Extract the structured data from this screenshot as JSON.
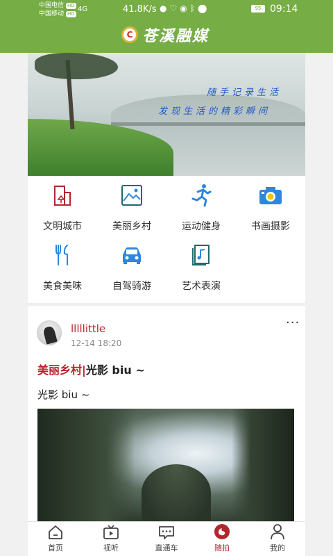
{
  "status_bar": {
    "carrier1": "中国电信",
    "carrier2": "中国移动",
    "hd_badge": "HD",
    "signal_text": "4G",
    "net_speed": "41.8K/s",
    "battery": "95",
    "time": "09:14"
  },
  "header": {
    "logo_mark": "C",
    "app_name": "苍溪融媒"
  },
  "banner": {
    "line1": "随手记录生活",
    "line2": "发现生活的精彩瞬间"
  },
  "categories": [
    {
      "label": "文明城市",
      "icon": "building-icon",
      "color": "#b3262d"
    },
    {
      "label": "美丽乡村",
      "icon": "landscape-icon",
      "color": "#1f6b6b"
    },
    {
      "label": "运动健身",
      "icon": "running-icon",
      "color": "#2e86de"
    },
    {
      "label": "书画摄影",
      "icon": "camera-icon",
      "color": "#2e86de"
    },
    {
      "label": "美食美味",
      "icon": "utensils-icon",
      "color": "#2e86de"
    },
    {
      "label": "自驾骑游",
      "icon": "car-icon",
      "color": "#2e86de"
    },
    {
      "label": "艺术表演",
      "icon": "music-icon",
      "color": "#1f6b6b"
    }
  ],
  "post": {
    "username": "lllllittle",
    "time": "12-14 18:20",
    "more": "···",
    "topic": "美丽乡村|",
    "title": "光影 biu ~",
    "body": "光影 biu ~"
  },
  "tabbar": [
    {
      "label": "首页",
      "icon": "home-icon",
      "active": false
    },
    {
      "label": "视听",
      "icon": "tv-icon",
      "active": false
    },
    {
      "label": "直通车",
      "icon": "message-icon",
      "active": false
    },
    {
      "label": "随拍",
      "icon": "snap-icon",
      "active": true
    },
    {
      "label": "我的",
      "icon": "user-icon",
      "active": false
    }
  ],
  "colors": {
    "brand_green": "#76ad45",
    "accent_red": "#b3262d"
  }
}
